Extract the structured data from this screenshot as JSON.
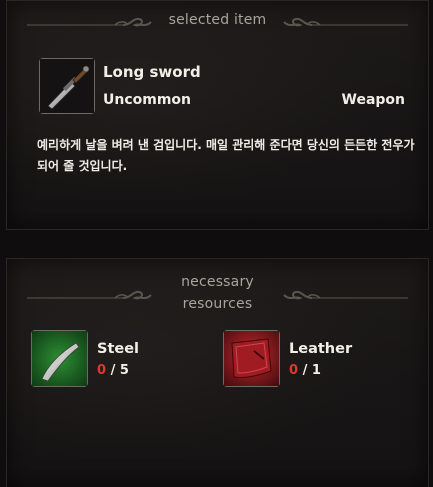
{
  "selected_item": {
    "header": "selected item",
    "name": "Long sword",
    "rarity": "Uncommon",
    "type": "Weapon",
    "icon": "sword-icon",
    "description": "예리하게 날을 벼려 낸 검입니다. 매일 관리해 준다면 당신의 든든한 전우가 되어 줄 것입니다."
  },
  "resources": {
    "header_line1": "necessary",
    "header_line2": "resources",
    "items": [
      {
        "name": "Steel",
        "have": "0",
        "sep": "/",
        "need": "5",
        "icon": "steel-blade-icon",
        "accent": "#2f9a3a"
      },
      {
        "name": "Leather",
        "have": "0",
        "sep": "/",
        "need": "1",
        "icon": "leather-icon",
        "accent": "#b3232a"
      }
    ]
  },
  "colors": {
    "missing_count": "#e0382e",
    "frame_border": "#6d6a66"
  }
}
